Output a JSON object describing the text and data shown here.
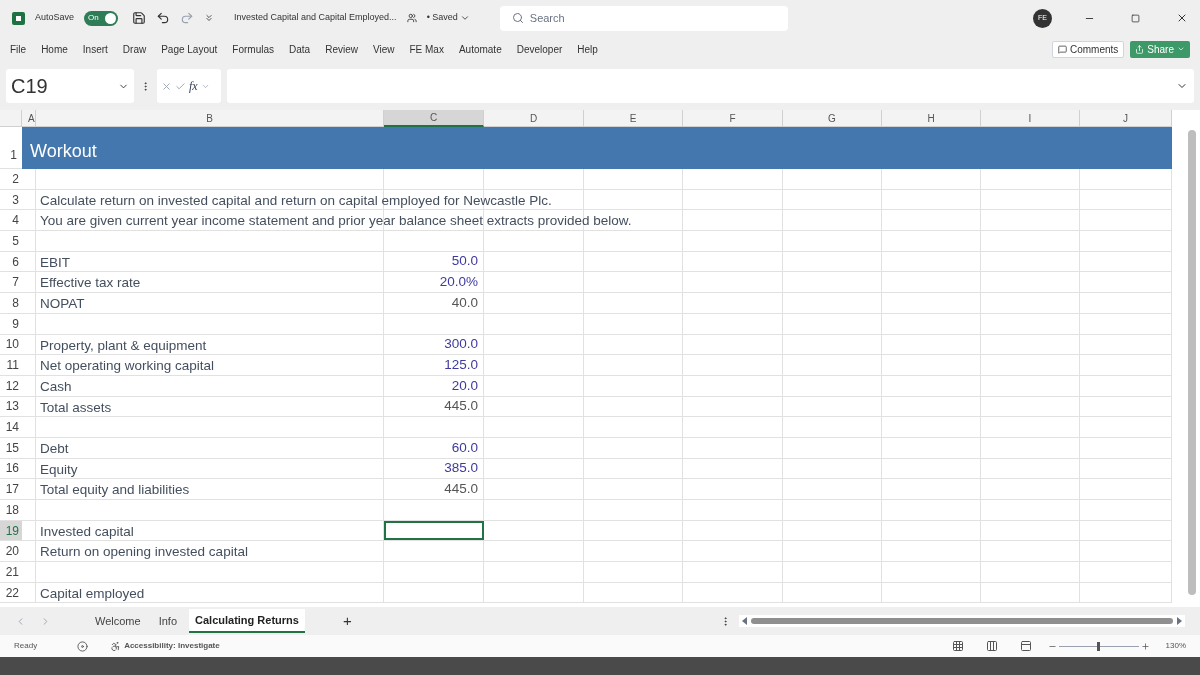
{
  "titlebar": {
    "autosave_label": "AutoSave",
    "autosave": {
      "label": "On",
      "on": true
    },
    "file_name": "Invested Capital and Capital Employed...",
    "saved": "• Saved",
    "search_placeholder": "Search",
    "avatar": "FE"
  },
  "ribbon_tabs": [
    "File",
    "Home",
    "Insert",
    "Draw",
    "Page Layout",
    "Formulas",
    "Data",
    "Review",
    "View",
    "FE Max",
    "Automate",
    "Developer",
    "Help"
  ],
  "ribbon_buttons": {
    "comments": "Comments",
    "share": "Share"
  },
  "formula_bar": {
    "name_box": "C19",
    "fx": "fx"
  },
  "columns": [
    "A",
    "B",
    "C",
    "D",
    "E",
    "F",
    "G",
    "H",
    "I",
    "J"
  ],
  "title_row": {
    "n": "1",
    "text": "Workout"
  },
  "rows": [
    {
      "n": "2",
      "selected": false
    },
    {
      "n": "3",
      "label": "Calculate return on invested capital and return on capital employed for Newcastle Plc.",
      "selected": false
    },
    {
      "n": "4",
      "label": "You are given current year income statement and prior year balance sheet extracts provided below.",
      "selected": false
    },
    {
      "n": "5",
      "selected": false
    },
    {
      "n": "6",
      "label": "EBIT",
      "value": "50.0",
      "kind": "input",
      "selected": false
    },
    {
      "n": "7",
      "label": "Effective tax rate",
      "value": "20.0%",
      "kind": "input",
      "selected": false
    },
    {
      "n": "8",
      "label": "NOPAT",
      "value": "40.0",
      "kind": "formula",
      "selected": false
    },
    {
      "n": "9",
      "selected": false
    },
    {
      "n": "10",
      "label": "Property, plant & equipment",
      "value": "300.0",
      "kind": "input",
      "selected": false
    },
    {
      "n": "11",
      "label": "Net operating working capital",
      "value": "125.0",
      "kind": "input",
      "selected": false
    },
    {
      "n": "12",
      "label": "Cash",
      "value": "20.0",
      "kind": "input",
      "selected": false
    },
    {
      "n": "13",
      "label": "Total assets",
      "value": "445.0",
      "kind": "formula",
      "selected": false
    },
    {
      "n": "14",
      "selected": false
    },
    {
      "n": "15",
      "label": "Debt",
      "value": "60.0",
      "kind": "input",
      "selected": false
    },
    {
      "n": "16",
      "label": "Equity",
      "value": "385.0",
      "kind": "input",
      "selected": false
    },
    {
      "n": "17",
      "label": "Total equity and liabilities",
      "value": "445.0",
      "kind": "formula",
      "selected": false
    },
    {
      "n": "18",
      "selected": false
    },
    {
      "n": "19",
      "label": "Invested capital",
      "selected": true
    },
    {
      "n": "20",
      "label": "Return on opening invested capital",
      "selected": false
    },
    {
      "n": "21",
      "selected": false
    },
    {
      "n": "22",
      "label": "Capital employed",
      "selected": false
    }
  ],
  "sheet_tabs": [
    {
      "label": "Welcome",
      "selected": false
    },
    {
      "label": "Info",
      "selected": false
    },
    {
      "label": "Calculating Returns",
      "selected": true
    }
  ],
  "add_sheet": "+",
  "status_bar": {
    "ready": "Ready",
    "accessibility": "Accessibility: Investigate",
    "zoom": {
      "level": 0.5
    },
    "zoom_label": "130%"
  }
}
